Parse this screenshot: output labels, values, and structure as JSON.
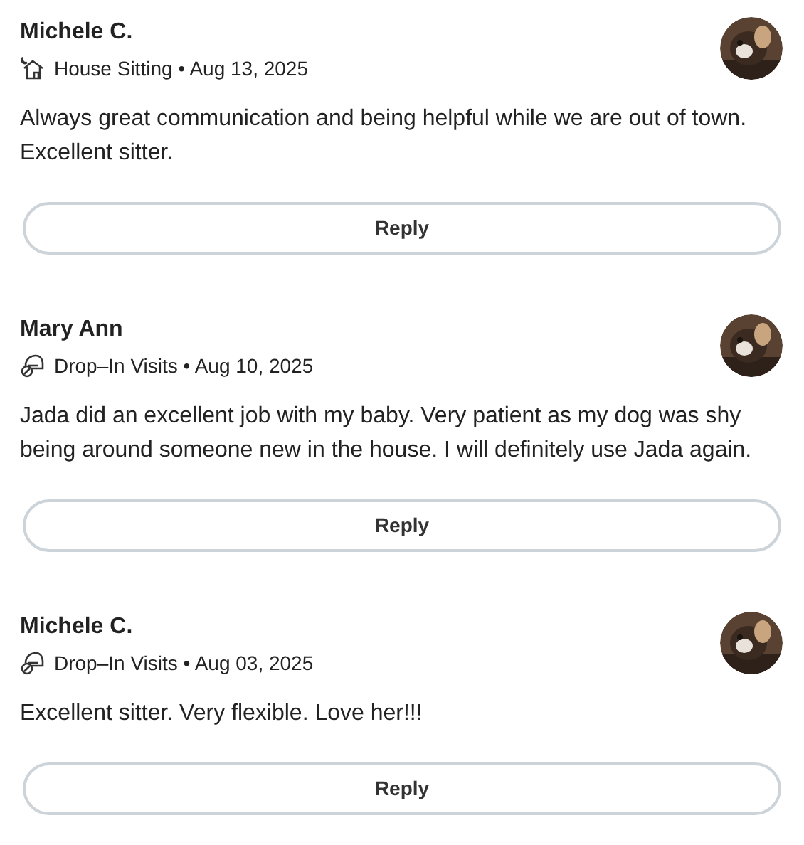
{
  "reviews": [
    {
      "name": "Michele C.",
      "service": {
        "kind": "house",
        "label": "House Sitting"
      },
      "separator": "•",
      "date": "Aug 13, 2025",
      "text": "Always great communication and being helpful while we are out of town. Excellent sitter.",
      "button": "Reply"
    },
    {
      "name": "Mary Ann",
      "service": {
        "kind": "dropin",
        "label": "Drop–In Visits"
      },
      "separator": "•",
      "date": "Aug 10, 2025",
      "text": "Jada did an excellent job with my baby. Very patient as my dog was shy being around someone new in the house. I will definitely use Jada again.",
      "button": "Reply"
    },
    {
      "name": "Michele C.",
      "service": {
        "kind": "dropin",
        "label": "Drop–In Visits"
      },
      "separator": "•",
      "date": "Aug 03, 2025",
      "text": "Excellent sitter. Very flexible. Love her!!!",
      "button": "Reply"
    }
  ]
}
